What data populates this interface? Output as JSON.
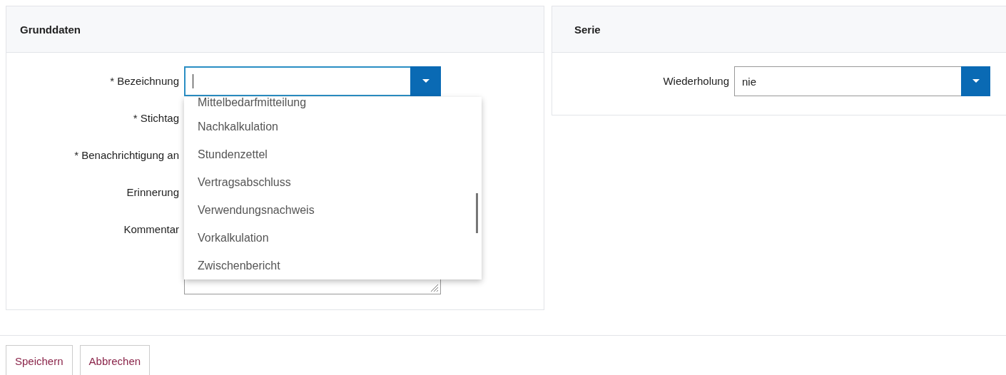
{
  "panels": [
    {
      "title": "Grunddaten",
      "fields": [
        {
          "label": "* Bezeichnung",
          "kind": "combo",
          "focused": true,
          "expanded": true,
          "options": [
            "Mittelbedarfmitteilung",
            "Nachkalkulation",
            "Stundenzettel",
            "Vertragsabschluss",
            "Verwendungsnachweis",
            "Vorkalkulation",
            "Zwischenbericht"
          ]
        },
        {
          "label": "* Stichtag",
          "kind": "covered"
        },
        {
          "label": "* Benachrichtigung an",
          "kind": "covered"
        },
        {
          "label": "Erinnerung",
          "kind": "covered"
        },
        {
          "label": "Kommentar",
          "kind": "textarea"
        }
      ]
    },
    {
      "title": "Serie",
      "fields": [
        {
          "label": "Wiederholung",
          "kind": "combo",
          "value": "nie",
          "focused": false,
          "expanded": false
        }
      ]
    }
  ],
  "buttons": [
    "Speichern",
    "Abbrechen"
  ]
}
